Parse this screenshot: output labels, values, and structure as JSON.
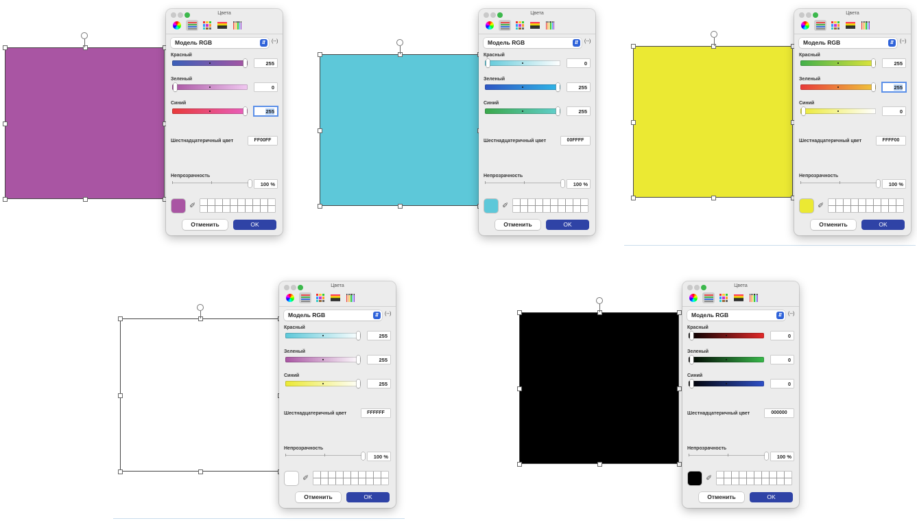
{
  "colors": {
    "accent_blue": "#2f43a6",
    "popup_arrow": "#2e62d9",
    "window_green": "#3cb84c"
  },
  "icons": [
    "color-wheel-icon",
    "sliders-icon",
    "palette-icon",
    "image-palette-icon",
    "crayons-icon",
    "eyedropper-icon",
    "rotate-handle-icon"
  ],
  "panels": [
    {
      "shape_color": "#a955a3",
      "dialog": {
        "title": "Цвета",
        "model": "Модель RGB",
        "model_more": "(--)",
        "red_label": "Красный",
        "red_value": "255",
        "green_label": "Зеленый",
        "green_value": "0",
        "blue_label": "Синий",
        "blue_value": "255",
        "hex_label": "Шестнадцатеричный цвет",
        "hex_value": "FF00FF",
        "opacity_label": "Непрозрачность",
        "opacity_value": "100 %",
        "cancel": "Отменить",
        "ok": "OK",
        "focused_field": "blue"
      }
    },
    {
      "shape_color": "#5dc8d9",
      "dialog": {
        "title": "Цвета",
        "model": "Модель RGB",
        "model_more": "(--)",
        "red_label": "Красный",
        "red_value": "0",
        "green_label": "Зеленый",
        "green_value": "255",
        "blue_label": "Синий",
        "blue_value": "255",
        "hex_label": "Шестнадцатеричный цвет",
        "hex_value": "00FFFF",
        "opacity_label": "Непрозрачность",
        "opacity_value": "100 %",
        "cancel": "Отменить",
        "ok": "OK",
        "focused_field": "none"
      }
    },
    {
      "shape_color": "#ebe933",
      "dialog": {
        "title": "Цвета",
        "model": "Модель RGB",
        "model_more": "(--)",
        "red_label": "Красный",
        "red_value": "255",
        "green_label": "Зеленый",
        "green_value": "255",
        "blue_label": "Синий",
        "blue_value": "0",
        "hex_label": "Шестнадцатеричный цвет",
        "hex_value": "FFFF00",
        "opacity_label": "Непрозрачность",
        "opacity_value": "100 %",
        "cancel": "Отменить",
        "ok": "OK",
        "focused_field": "green"
      }
    },
    {
      "shape_color": "#ffffff",
      "dialog": {
        "title": "Цвета",
        "model": "Модель RGB",
        "model_more": "(--)",
        "red_label": "Красный",
        "red_value": "255",
        "green_label": "Зеленый",
        "green_value": "255",
        "blue_label": "Синий",
        "blue_value": "255",
        "hex_label": "Шестнадцатеричный цвет",
        "hex_value": "FFFFFF",
        "opacity_label": "Непрозрачность",
        "opacity_value": "100 %",
        "cancel": "Отменить",
        "ok": "OK",
        "focused_field": "none"
      }
    },
    {
      "shape_color": "#000000",
      "dialog": {
        "title": "Цвета",
        "model": "Модель RGB",
        "model_more": "(--)",
        "red_label": "Красный",
        "red_value": "0",
        "green_label": "Зеленый",
        "green_value": "0",
        "blue_label": "Синий",
        "blue_value": "0",
        "hex_label": "Шестнадцатеричный цвет",
        "hex_value": "000000",
        "opacity_label": "Непрозрачность",
        "opacity_value": "100 %",
        "cancel": "Отменить",
        "ok": "OK",
        "focused_field": "none"
      }
    }
  ]
}
